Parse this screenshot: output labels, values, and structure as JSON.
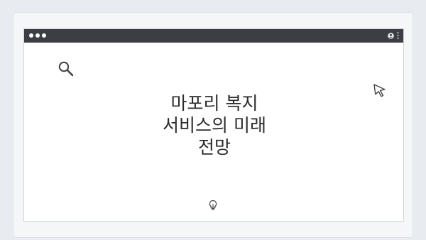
{
  "heading": {
    "line1": "마포리 복지",
    "line2": "서비스의 미래",
    "line3": "전망"
  },
  "icons": {
    "search": "search-icon",
    "cursor": "cursor-icon",
    "bulb": "lightbulb-icon",
    "user": "user-icon",
    "menu": "more-vertical-icon"
  },
  "colors": {
    "titlebar": "#3c3e44",
    "background": "#e8ecf0",
    "text": "#2b2b2b"
  }
}
